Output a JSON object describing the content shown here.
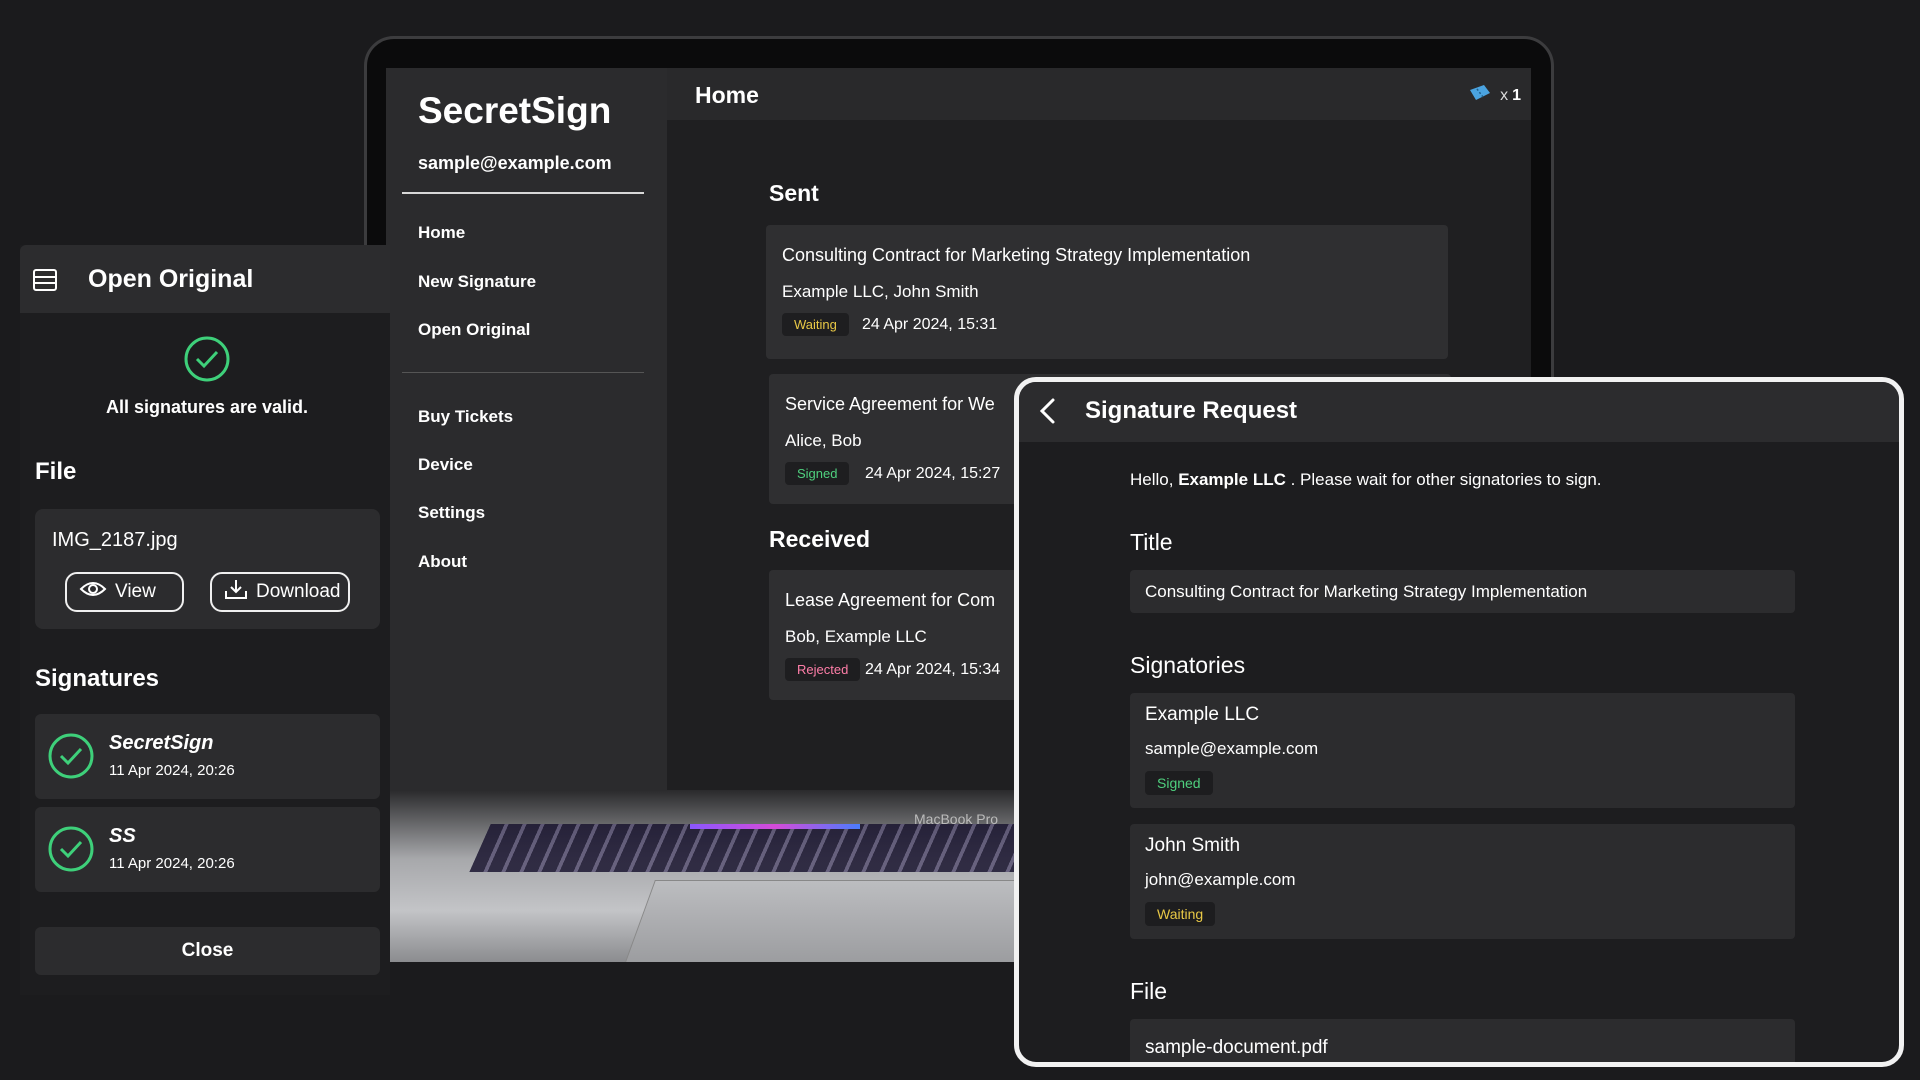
{
  "app": {
    "name": "SecretSign",
    "email": "sample@example.com",
    "nav_primary": [
      "Home",
      "New Signature",
      "Open Original"
    ],
    "nav_secondary": [
      "Buy Tickets",
      "Device",
      "Settings",
      "About"
    ]
  },
  "topbar": {
    "title": "Home",
    "ticket_prefix": "x",
    "ticket_count": "1"
  },
  "home": {
    "sent_heading": "Sent",
    "received_heading": "Received",
    "sent": [
      {
        "title": "Consulting Contract for Marketing Strategy Implementation",
        "parties": "Example LLC, John Smith",
        "status": "Waiting",
        "date": "24 Apr 2024, 15:31"
      },
      {
        "title": "Service Agreement for We",
        "parties": "Alice, Bob",
        "status": "Signed",
        "date": "24 Apr 2024, 15:27"
      }
    ],
    "received": [
      {
        "title": "Lease Agreement for Com",
        "parties": "Bob, Example LLC",
        "status": "Rejected",
        "date": "24 Apr 2024, 15:34"
      }
    ]
  },
  "laptop_label": "MacBook Pro",
  "open_original": {
    "title": "Open Original",
    "status_text": "All signatures are valid.",
    "file_heading": "File",
    "file_name": "IMG_2187.jpg",
    "view_label": "View",
    "download_label": "Download",
    "signatures_heading": "Signatures",
    "signatures": [
      {
        "name": "SecretSign",
        "date": "11 Apr 2024, 20:26"
      },
      {
        "name": "SS",
        "date": "11 Apr 2024, 20:26"
      }
    ],
    "close_label": "Close"
  },
  "signature_request": {
    "title": "Signature Request",
    "hello_prefix": "Hello, ",
    "hello_name": "Example LLC",
    "hello_suffix": " . Please wait for other signatories to sign.",
    "title_heading": "Title",
    "title_value": "Consulting Contract for Marketing Strategy Implementation",
    "signatories_heading": "Signatories",
    "signatories": [
      {
        "name": "Example LLC",
        "email": "sample@example.com",
        "status": "Signed"
      },
      {
        "name": "John Smith",
        "email": "john@example.com",
        "status": "Waiting"
      }
    ],
    "file_heading": "File",
    "file_name": "sample-document.pdf"
  },
  "colors": {
    "waiting": "#e8c846",
    "signed": "#4fd07e",
    "rejected": "#ff7ea8",
    "valid": "#3ed07a",
    "ticket": "#4aa3e0"
  },
  "icons": [
    "menu-icon",
    "check-circle-icon",
    "eye-icon",
    "download-icon",
    "ticket-icon",
    "chevron-left-icon"
  ]
}
